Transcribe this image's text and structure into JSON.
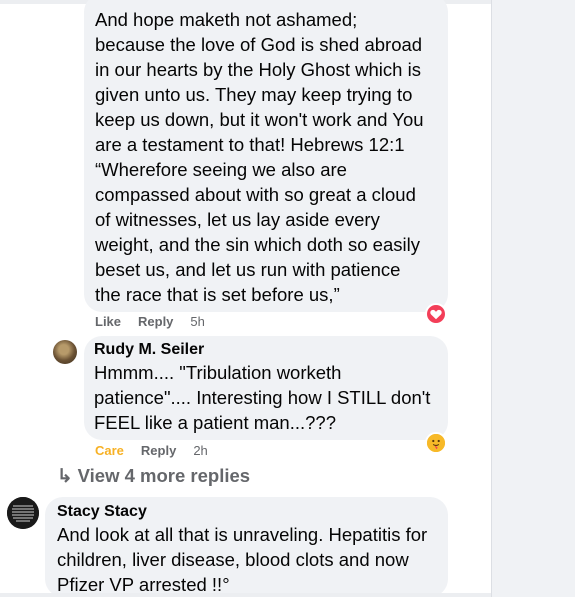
{
  "colors": {
    "bubble_bg": "#f0f2f5",
    "secondary_text": "#65676b",
    "care_reaction": "#f7b125",
    "love_reaction": "#f33e58"
  },
  "comments": [
    {
      "text": "And hope maketh not ashamed;\nbecause the love of God is shed abroad\nin our hearts by the Holy Ghost which is\ngiven unto us. They may keep trying to\nkeep us down, but it won't work and You\nare a testament to that! Hebrews 12:1\n“Wherefore seeing we also are\ncompassed about with so great a cloud\nof witnesses, let us lay aside every\nweight, and the sin which doth so easily\nbeset us, and let us run with patience\nthe race that is set before us,”",
      "actions": {
        "like": "Like",
        "reply": "Reply",
        "time": "5h"
      },
      "reaction_icon": "heart-icon"
    },
    {
      "author": "Rudy M. Seiler",
      "text": "Hmmm.... \"Tribulation worketh\npatience\".... Interesting how I STILL don't\nFEEL like a patient man...???",
      "actions": {
        "reaction": "Care",
        "reply": "Reply",
        "time": "2h"
      },
      "reaction_icon": "care-hug-icon"
    },
    {
      "author": "Stacy Stacy",
      "text": "And look at all that is unraveling. Hepatitis for\nchildren, liver disease, blood clots and now\nPfizer VP arrested !!°"
    }
  ],
  "view_more": {
    "arrow": "↳",
    "label": "View 4 more replies"
  }
}
